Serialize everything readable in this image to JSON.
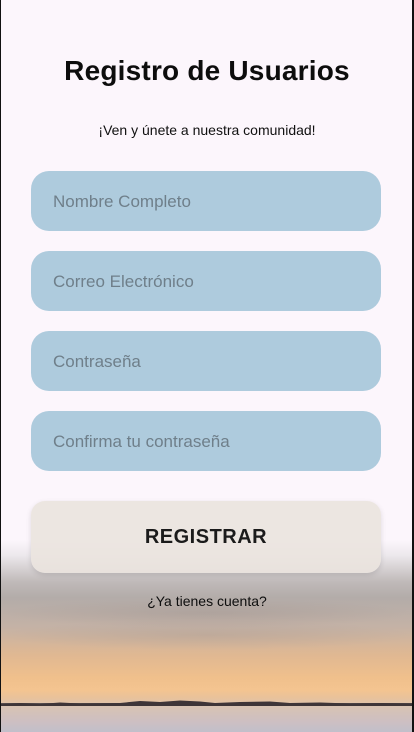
{
  "header": {
    "title": "Registro de Usuarios",
    "subtitle": "¡Ven y únete a nuestra comunidad!"
  },
  "form": {
    "full_name": {
      "placeholder": "Nombre Completo",
      "value": ""
    },
    "email": {
      "placeholder": "Correo Electrónico",
      "value": ""
    },
    "password": {
      "placeholder": "Contraseña",
      "value": ""
    },
    "confirm_password": {
      "placeholder": "Confirma tu contraseña",
      "value": ""
    },
    "register_label": "REGISTRAR"
  },
  "footer": {
    "login_link": "¿Ya tienes cuenta?"
  },
  "colors": {
    "background": "#fcf6fc",
    "field_background": "#aecbdd",
    "button_background": "#eae4de",
    "text": "#0d0d0d"
  },
  "background_image": "sunset-salt-flat-landscape"
}
